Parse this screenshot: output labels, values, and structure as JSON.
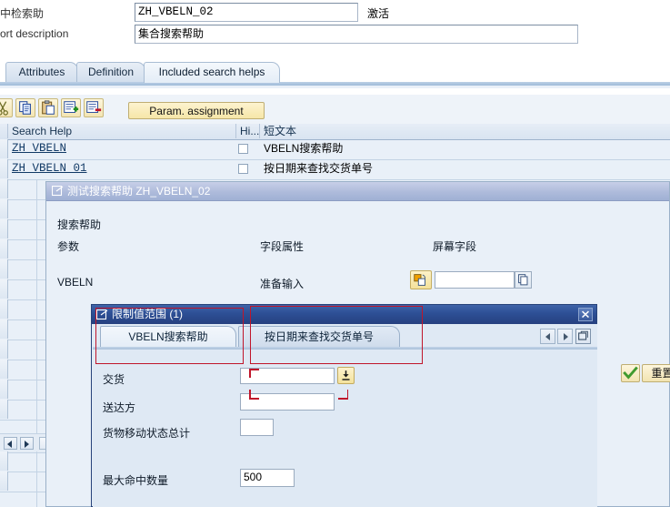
{
  "header": {
    "fields": [
      {
        "label": "中检索助",
        "value": "ZH_VBELN_02",
        "status": "激活"
      },
      {
        "label": "ort description",
        "value": "集合搜索帮助",
        "status": ""
      }
    ]
  },
  "tabstrip": {
    "tabs": [
      {
        "label": "Attributes",
        "active": false
      },
      {
        "label": "Definition",
        "active": false
      },
      {
        "label": "Included search helps",
        "active": true
      }
    ]
  },
  "toolbar": {
    "icons": [
      {
        "name": "cut-icon"
      },
      {
        "name": "copy-icon"
      },
      {
        "name": "paste-icon"
      },
      {
        "name": "insert-row-icon"
      },
      {
        "name": "delete-row-icon"
      }
    ],
    "param_assignment_label": "Param. assignment"
  },
  "grid": {
    "columns": [
      {
        "label": "Search Help"
      },
      {
        "label": "Hi..."
      },
      {
        "label": "短文本"
      }
    ],
    "rows": [
      {
        "search_help": "ZH_VBELN",
        "hidden": false,
        "short_text": "VBELN搜索帮助"
      },
      {
        "search_help": "ZH_VBELN_01",
        "hidden": false,
        "short_text": "按日期来查找交货单号"
      }
    ]
  },
  "test_dialog": {
    "title": "测试搜索帮助 ZH_VBELN_02",
    "section_label": "搜索帮助",
    "col_parameter": "参数",
    "col_field_attribute": "字段属性",
    "col_screen_field": "屏幕字段",
    "row": {
      "parameter": "VBELN",
      "field_attribute": "准备输入",
      "screen_field_value": ""
    }
  },
  "restrict_dialog": {
    "title": "限制值范围 (1)",
    "tabs": [
      {
        "label": "VBELN搜索帮助",
        "active": true
      },
      {
        "label": "按日期来查找交货单号",
        "active": false
      }
    ],
    "fields": [
      {
        "label": "交货",
        "value": "",
        "has_f4": true
      },
      {
        "label": "送达方",
        "value": "",
        "has_f4": false
      },
      {
        "label": "货物移动状态总计",
        "value": "",
        "has_f4": false
      },
      {
        "label": "最大命中数量",
        "value": "500",
        "has_f4": false
      }
    ],
    "execute_label": "",
    "reset_label": "重置",
    "close_label": "×"
  },
  "colors": {
    "accent": "#2d4f95",
    "annotation": "#c0152a",
    "button_yellow": "#f3e5b4",
    "grid_bg": "#e9f0f8",
    "confirm_green": "#3f9a2e"
  }
}
